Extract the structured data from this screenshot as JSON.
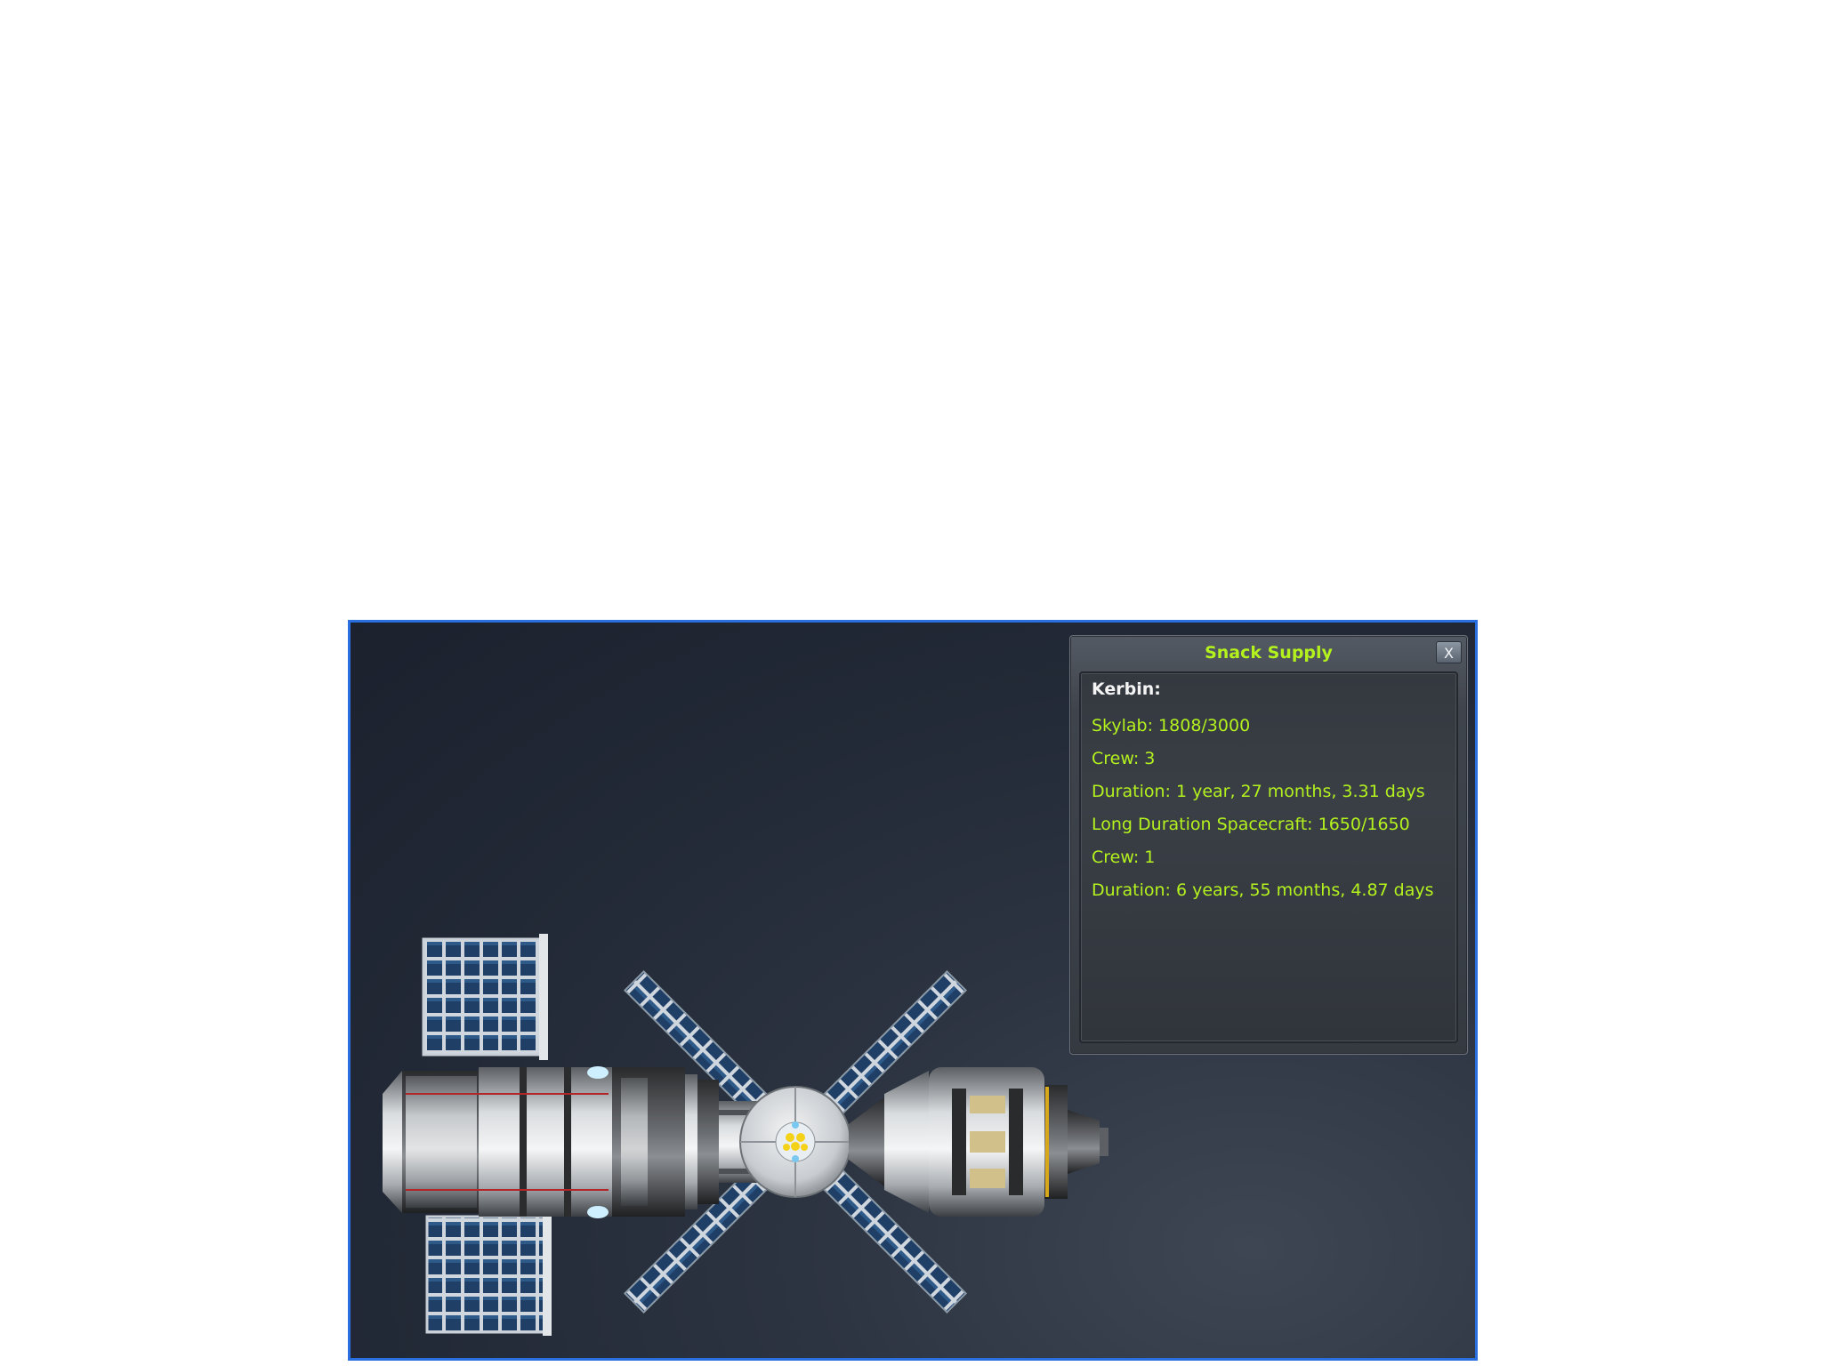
{
  "window": {
    "title": "Snack Supply",
    "close_label": "X",
    "planet_label": "Kerbin:",
    "entries": [
      "Skylab: 1808/3000",
      "Crew: 3",
      "Duration: 1 year, 27 months, 3.31 days",
      "Long Duration Spacecraft: 1650/1650",
      "Crew: 1",
      "Duration: 6 years, 55 months, 4.87 days"
    ]
  },
  "colors": {
    "title": "#b4f21e",
    "text": "#b4f21e",
    "heading": "#f4f4f4",
    "viewport_border": "#2a6fe0"
  }
}
